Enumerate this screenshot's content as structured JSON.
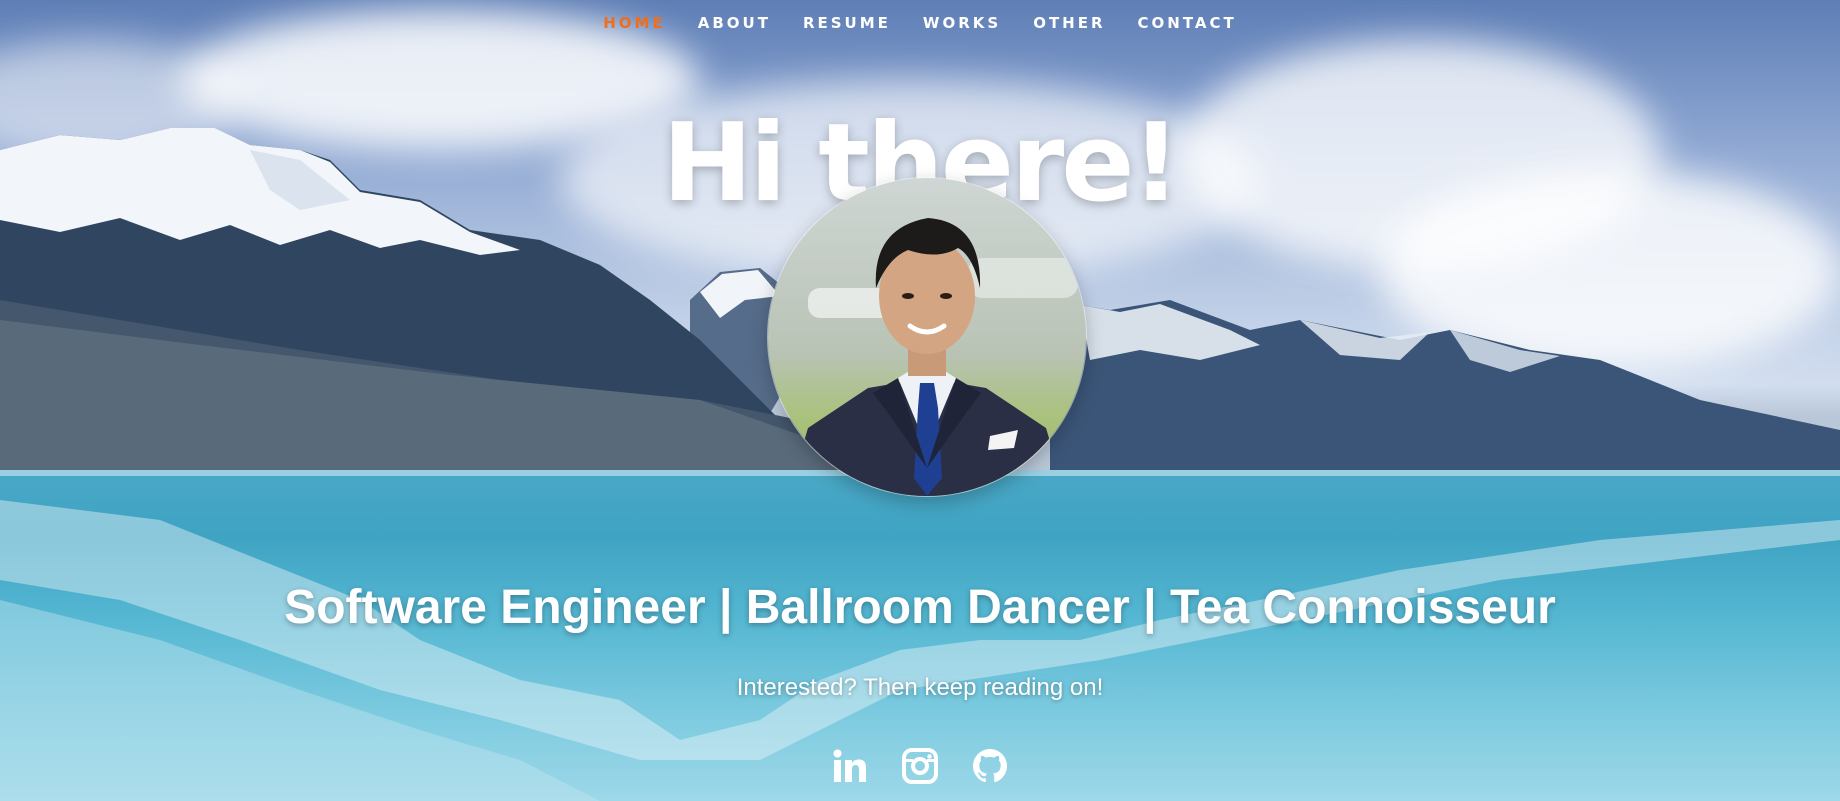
{
  "nav": {
    "items": [
      {
        "label": "HOME",
        "active": true
      },
      {
        "label": "ABOUT"
      },
      {
        "label": "RESUME"
      },
      {
        "label": "WORKS"
      },
      {
        "label": "OTHER"
      },
      {
        "label": "CONTACT"
      }
    ],
    "active_color": "#f06d1a"
  },
  "hero": {
    "headline": "Hi there!",
    "subtitle": "Software Engineer | Ballroom Dancer | Tea Connoisseur",
    "cta": "Interested? Then keep reading on!"
  },
  "social": {
    "icons": [
      "linkedin-icon",
      "instagram-icon",
      "github-icon"
    ]
  },
  "colors": {
    "text": "#ffffff",
    "accent": "#f06d1a"
  }
}
